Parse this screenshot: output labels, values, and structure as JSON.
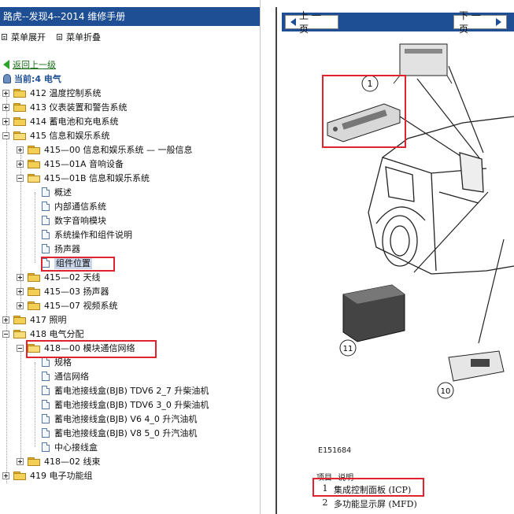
{
  "left_panel": {
    "title": "路虎--发现4--2014 维修手册",
    "menu": {
      "expand_label": "菜单展开",
      "collapse_label": "菜单折叠"
    },
    "back_link": "返回上一级",
    "current_location": "当前:4 电气",
    "tree": [
      {
        "label": "412 温度控制系统",
        "type": "folder",
        "state": "collapsed"
      },
      {
        "label": "413 仪表装置和警告系统",
        "type": "folder",
        "state": "collapsed"
      },
      {
        "label": "414 蓄电池和充电系统",
        "type": "folder",
        "state": "collapsed"
      },
      {
        "label": "415 信息和娱乐系统",
        "type": "folder",
        "state": "expanded"
      },
      {
        "label": "415—00 信息和娱乐系统 — 一般信息",
        "type": "folder",
        "state": "collapsed"
      },
      {
        "label": "415—01A 音响设备",
        "type": "folder",
        "state": "collapsed"
      },
      {
        "label": "415—01B 信息和娱乐系统",
        "type": "folder",
        "state": "expanded"
      },
      {
        "label": "概述",
        "type": "page"
      },
      {
        "label": "内部通信系统",
        "type": "page"
      },
      {
        "label": "数字音响模块",
        "type": "page"
      },
      {
        "label": "系统操作和组件说明",
        "type": "page"
      },
      {
        "label": "扬声器",
        "type": "page"
      },
      {
        "label": "组件位置",
        "type": "page",
        "selected": true
      },
      {
        "label": "415—02 天线",
        "type": "folder",
        "state": "collapsed"
      },
      {
        "label": "415—03 扬声器",
        "type": "folder",
        "state": "collapsed"
      },
      {
        "label": "415—07 视频系统",
        "type": "folder",
        "state": "collapsed"
      },
      {
        "label": "417 照明",
        "type": "folder",
        "state": "collapsed"
      },
      {
        "label": "418 电气分配",
        "type": "folder",
        "state": "expanded"
      },
      {
        "label": "418—00 模块通信网络",
        "type": "folder",
        "state": "expanded"
      },
      {
        "label": "规格",
        "type": "page"
      },
      {
        "label": "通信网络",
        "type": "page"
      },
      {
        "label": "蓄电池接线盒(BJB) TDV6 2_7 升柴油机",
        "type": "page"
      },
      {
        "label": "蓄电池接线盒(BJB) TDV6 3_0 升柴油机",
        "type": "page"
      },
      {
        "label": "蓄电池接线盒(BJB) V6 4_0 升汽油机",
        "type": "page"
      },
      {
        "label": "蓄电池接线盒(BJB) V8 5_0 升汽油机",
        "type": "page"
      },
      {
        "label": "中心接线盒",
        "type": "page"
      },
      {
        "label": "418—02 线束",
        "type": "folder",
        "state": "collapsed"
      },
      {
        "label": "419 电子功能组",
        "type": "folder",
        "state": "collapsed"
      }
    ]
  },
  "right_panel": {
    "prev_button": "上 一 页",
    "next_button": "下 一 页",
    "figure": {
      "callouts": [
        "1",
        "11",
        "10"
      ],
      "figure_id": "E151684"
    },
    "legend": {
      "header_item": "项目",
      "header_desc": "说明",
      "rows": [
        {
          "num": "1",
          "desc": "集成控制面板 (ICP)"
        },
        {
          "num": "2",
          "desc": "多功能显示屏 (MFD)"
        }
      ]
    }
  },
  "colors": {
    "title_bar": "#1e4f94",
    "highlight": "#e0242f",
    "link": "#1b6e1b"
  }
}
